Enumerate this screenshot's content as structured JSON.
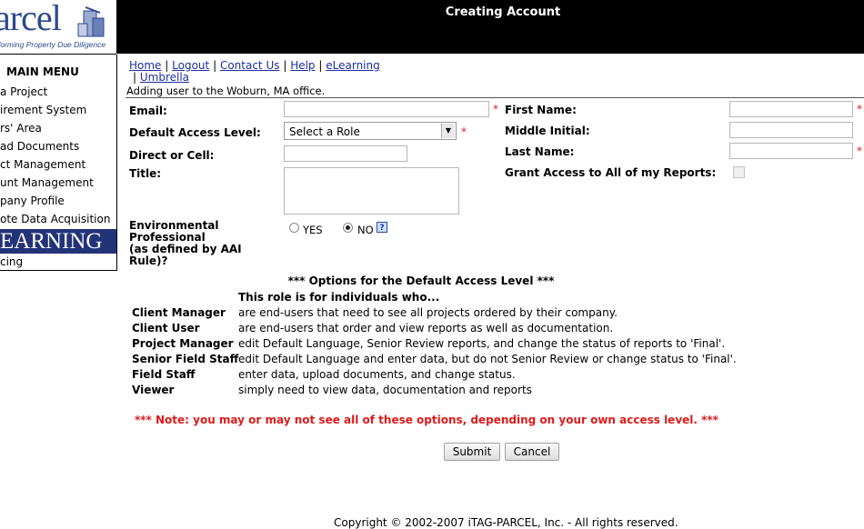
{
  "header": {
    "title": "Creating Account",
    "logo_text": "arcel",
    "logo_tagline": "forming Property Due Diligence"
  },
  "sidebar": {
    "title": "MAIN MENU",
    "items": [
      {
        "label": "a Project"
      },
      {
        "label": "irement System"
      },
      {
        "label": "rs' Area"
      },
      {
        "label": "ad Documents"
      },
      {
        "label": "ct Management"
      },
      {
        "label": "unt Management"
      },
      {
        "label": "pany Profile"
      },
      {
        "label": "ote Data Acquisition"
      }
    ],
    "elearning_banner": "EARNING",
    "last_item": "cing"
  },
  "nav": {
    "links": [
      "Home",
      "Logout",
      "Contact Us",
      "Help",
      "eLearning",
      "Umbrella"
    ],
    "separator": "|"
  },
  "office_note": "Adding user to the Woburn, MA office.",
  "form": {
    "email_label": "Email:",
    "email_value": "",
    "access_label": "Default Access Level:",
    "access_value": "Select a Role",
    "phone_label": "Direct or Cell:",
    "phone_value": "",
    "title_label": "Title:",
    "title_value": "",
    "env_label_lines": [
      "Environmental",
      "Professional",
      "(as defined by AAI",
      "Rule)?"
    ],
    "env_options": [
      {
        "label": "YES",
        "selected": false
      },
      {
        "label": "NO",
        "selected": true
      }
    ],
    "help_icon": "?",
    "first_name_label": "First Name:",
    "middle_initial_label": "Middle Initial:",
    "last_name_label": "Last Name:",
    "grant_label": "Grant Access to All of my Reports:",
    "grant_checked": false,
    "required_mark": "*"
  },
  "options": {
    "title": "*** Options for the Default Access Level ***",
    "subtitle": "This role is for individuals who...",
    "roles": [
      {
        "name": "Client Manager",
        "desc": "are end-users that need to see all projects ordered by their company."
      },
      {
        "name": "Client User",
        "desc": "are end-users that order and view reports as well as documentation."
      },
      {
        "name": "Project Manager",
        "desc": "edit Default Language, Senior Review reports, and change the status of reports to 'Final'."
      },
      {
        "name": "Senior Field Staff",
        "desc": "edit Default Language and enter data, but do not Senior Review or change status to 'Final'."
      },
      {
        "name": "Field Staff",
        "desc": "enter data, upload documents, and change status."
      },
      {
        "name": "Viewer",
        "desc": "simply need to view data, documentation and reports"
      }
    ],
    "note": "*** Note: you may or may not see all of these options, depending on your own access level. ***"
  },
  "buttons": {
    "submit": "Submit",
    "cancel": "Cancel"
  },
  "footer": {
    "copyright": "Copyright © 2002-2007 iTAG-PARCEL, Inc. - All rights reserved."
  },
  "colors": {
    "brand": "#2c4a8e",
    "link": "#1d2fa3",
    "required": "#e01a1a",
    "banner": "#223377"
  }
}
